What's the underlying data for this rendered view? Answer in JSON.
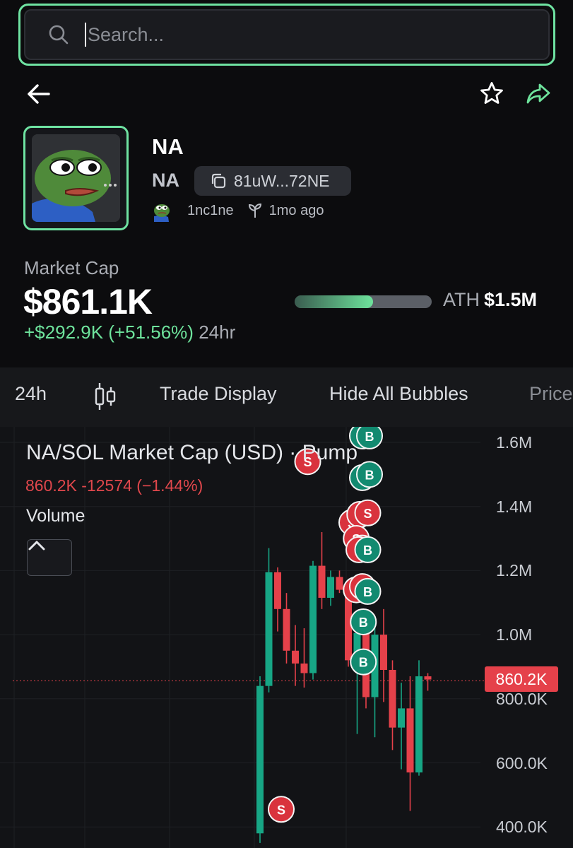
{
  "search": {
    "placeholder": "Search..."
  },
  "header": {
    "icons": {
      "back": "arrow-left-icon",
      "favorite": "star-icon",
      "share": "share-icon"
    },
    "accent_color": "#6fe3a2"
  },
  "token": {
    "name": "NA",
    "symbol": "NA",
    "address": "81uW...72NE",
    "creator": "1nc1ne",
    "created_age": "1mo ago",
    "avatar": "frog-avatar"
  },
  "market": {
    "label": "Market Cap",
    "value": "$861.1K",
    "change": "+$292.9K (+51.56%)",
    "period": "24hr",
    "ath_label": "ATH",
    "ath_value": "$1.5M",
    "ath_progress": 0.57,
    "positive_color": "#6ee39c",
    "negative_color": "#e5414a"
  },
  "toolbar": {
    "timeframe": "24h",
    "trade_display": "Trade Display",
    "hide_bubbles": "Hide All Bubbles",
    "price": "Price"
  },
  "chart_data": {
    "type": "candlestick",
    "title": "NA/SOL Market Cap (USD) · Pump",
    "ohlc_summary": "860.2K  -12574 (−1.44%)",
    "volume_label": "Volume",
    "last_price": 860.2,
    "last_price_label": "860.2K",
    "y_ticks": [
      "1.6M",
      "1.4M",
      "1.2M",
      "1.0M",
      "800.0K",
      "600.0K",
      "400.0K"
    ],
    "y_tick_values": [
      1600,
      1400,
      1200,
      1000,
      800,
      600,
      400
    ],
    "y_unit": "K USD",
    "candles": [
      {
        "o": 380,
        "h": 870,
        "l": 350,
        "c": 840
      },
      {
        "o": 840,
        "h": 1270,
        "l": 820,
        "c": 1195
      },
      {
        "o": 1195,
        "h": 1210,
        "l": 1010,
        "c": 1080
      },
      {
        "o": 1080,
        "h": 1130,
        "l": 910,
        "c": 950
      },
      {
        "o": 950,
        "h": 1030,
        "l": 840,
        "c": 910
      },
      {
        "o": 910,
        "h": 1020,
        "l": 835,
        "c": 880
      },
      {
        "o": 880,
        "h": 1230,
        "l": 860,
        "c": 1215
      },
      {
        "o": 1215,
        "h": 1320,
        "l": 1080,
        "c": 1115
      },
      {
        "o": 1115,
        "h": 1200,
        "l": 1090,
        "c": 1180
      },
      {
        "o": 1180,
        "h": 1200,
        "l": 1130,
        "c": 1140
      },
      {
        "o": 1140,
        "h": 1150,
        "l": 900,
        "c": 920
      },
      {
        "o": 920,
        "h": 1060,
        "l": 690,
        "c": 1005
      },
      {
        "o": 1005,
        "h": 1040,
        "l": 770,
        "c": 805
      },
      {
        "o": 805,
        "h": 1020,
        "l": 680,
        "c": 1000
      },
      {
        "o": 1000,
        "h": 1080,
        "l": 790,
        "c": 890
      },
      {
        "o": 890,
        "h": 920,
        "l": 640,
        "c": 710
      },
      {
        "o": 710,
        "h": 850,
        "l": 580,
        "c": 770
      },
      {
        "o": 770,
        "h": 870,
        "l": 450,
        "c": 570
      },
      {
        "o": 570,
        "h": 920,
        "l": 560,
        "c": 870
      },
      {
        "o": 870,
        "h": 880,
        "l": 825,
        "c": 860
      }
    ],
    "bubbles": [
      {
        "candle": 5.4,
        "price": 1540,
        "type": "S"
      },
      {
        "candle": 11.6,
        "price": 1620,
        "type": "B"
      },
      {
        "candle": 12.4,
        "price": 1620,
        "type": "B"
      },
      {
        "candle": 11.6,
        "price": 1490,
        "type": "B"
      },
      {
        "candle": 12.4,
        "price": 1500,
        "type": "B"
      },
      {
        "candle": 10.4,
        "price": 1350,
        "type": "S"
      },
      {
        "candle": 11.3,
        "price": 1375,
        "type": "S"
      },
      {
        "candle": 12.2,
        "price": 1380,
        "type": "S"
      },
      {
        "candle": 10.9,
        "price": 1300,
        "type": "S"
      },
      {
        "candle": 11.6,
        "price": 1270,
        "type": "S"
      },
      {
        "candle": 11.2,
        "price": 1265,
        "type": "S"
      },
      {
        "candle": 12.2,
        "price": 1265,
        "type": "B"
      },
      {
        "candle": 10.9,
        "price": 1140,
        "type": "S"
      },
      {
        "candle": 11.6,
        "price": 1150,
        "type": "S"
      },
      {
        "candle": 12.2,
        "price": 1135,
        "type": "B"
      },
      {
        "candle": 11.7,
        "price": 1040,
        "type": "B"
      },
      {
        "candle": 11.7,
        "price": 915,
        "type": "B"
      },
      {
        "candle": 2.4,
        "price": 455,
        "type": "S"
      }
    ]
  }
}
